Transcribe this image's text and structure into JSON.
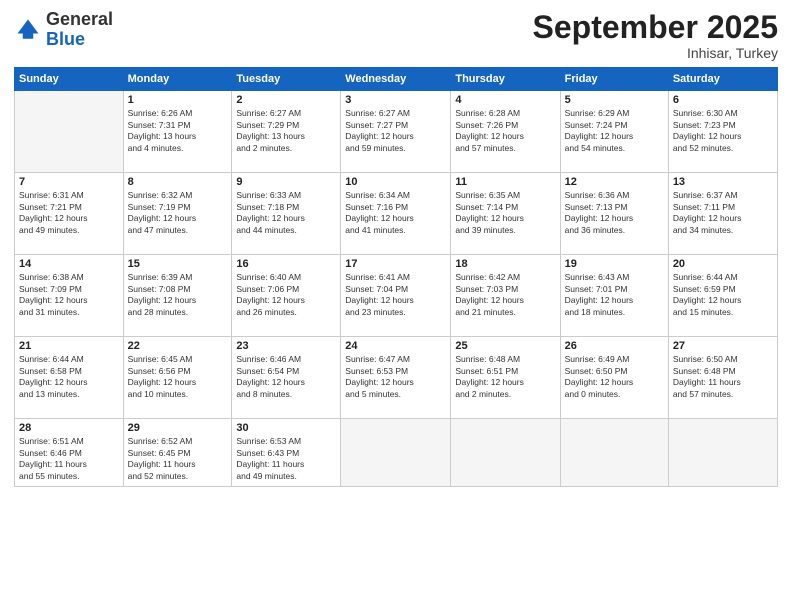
{
  "logo": {
    "general": "General",
    "blue": "Blue"
  },
  "header": {
    "month": "September 2025",
    "location": "Inhisar, Turkey"
  },
  "weekdays": [
    "Sunday",
    "Monday",
    "Tuesday",
    "Wednesday",
    "Thursday",
    "Friday",
    "Saturday"
  ],
  "weeks": [
    [
      {
        "day": "",
        "info": ""
      },
      {
        "day": "1",
        "info": "Sunrise: 6:26 AM\nSunset: 7:31 PM\nDaylight: 13 hours\nand 4 minutes."
      },
      {
        "day": "2",
        "info": "Sunrise: 6:27 AM\nSunset: 7:29 PM\nDaylight: 13 hours\nand 2 minutes."
      },
      {
        "day": "3",
        "info": "Sunrise: 6:27 AM\nSunset: 7:27 PM\nDaylight: 12 hours\nand 59 minutes."
      },
      {
        "day": "4",
        "info": "Sunrise: 6:28 AM\nSunset: 7:26 PM\nDaylight: 12 hours\nand 57 minutes."
      },
      {
        "day": "5",
        "info": "Sunrise: 6:29 AM\nSunset: 7:24 PM\nDaylight: 12 hours\nand 54 minutes."
      },
      {
        "day": "6",
        "info": "Sunrise: 6:30 AM\nSunset: 7:23 PM\nDaylight: 12 hours\nand 52 minutes."
      }
    ],
    [
      {
        "day": "7",
        "info": "Sunrise: 6:31 AM\nSunset: 7:21 PM\nDaylight: 12 hours\nand 49 minutes."
      },
      {
        "day": "8",
        "info": "Sunrise: 6:32 AM\nSunset: 7:19 PM\nDaylight: 12 hours\nand 47 minutes."
      },
      {
        "day": "9",
        "info": "Sunrise: 6:33 AM\nSunset: 7:18 PM\nDaylight: 12 hours\nand 44 minutes."
      },
      {
        "day": "10",
        "info": "Sunrise: 6:34 AM\nSunset: 7:16 PM\nDaylight: 12 hours\nand 41 minutes."
      },
      {
        "day": "11",
        "info": "Sunrise: 6:35 AM\nSunset: 7:14 PM\nDaylight: 12 hours\nand 39 minutes."
      },
      {
        "day": "12",
        "info": "Sunrise: 6:36 AM\nSunset: 7:13 PM\nDaylight: 12 hours\nand 36 minutes."
      },
      {
        "day": "13",
        "info": "Sunrise: 6:37 AM\nSunset: 7:11 PM\nDaylight: 12 hours\nand 34 minutes."
      }
    ],
    [
      {
        "day": "14",
        "info": "Sunrise: 6:38 AM\nSunset: 7:09 PM\nDaylight: 12 hours\nand 31 minutes."
      },
      {
        "day": "15",
        "info": "Sunrise: 6:39 AM\nSunset: 7:08 PM\nDaylight: 12 hours\nand 28 minutes."
      },
      {
        "day": "16",
        "info": "Sunrise: 6:40 AM\nSunset: 7:06 PM\nDaylight: 12 hours\nand 26 minutes."
      },
      {
        "day": "17",
        "info": "Sunrise: 6:41 AM\nSunset: 7:04 PM\nDaylight: 12 hours\nand 23 minutes."
      },
      {
        "day": "18",
        "info": "Sunrise: 6:42 AM\nSunset: 7:03 PM\nDaylight: 12 hours\nand 21 minutes."
      },
      {
        "day": "19",
        "info": "Sunrise: 6:43 AM\nSunset: 7:01 PM\nDaylight: 12 hours\nand 18 minutes."
      },
      {
        "day": "20",
        "info": "Sunrise: 6:44 AM\nSunset: 6:59 PM\nDaylight: 12 hours\nand 15 minutes."
      }
    ],
    [
      {
        "day": "21",
        "info": "Sunrise: 6:44 AM\nSunset: 6:58 PM\nDaylight: 12 hours\nand 13 minutes."
      },
      {
        "day": "22",
        "info": "Sunrise: 6:45 AM\nSunset: 6:56 PM\nDaylight: 12 hours\nand 10 minutes."
      },
      {
        "day": "23",
        "info": "Sunrise: 6:46 AM\nSunset: 6:54 PM\nDaylight: 12 hours\nand 8 minutes."
      },
      {
        "day": "24",
        "info": "Sunrise: 6:47 AM\nSunset: 6:53 PM\nDaylight: 12 hours\nand 5 minutes."
      },
      {
        "day": "25",
        "info": "Sunrise: 6:48 AM\nSunset: 6:51 PM\nDaylight: 12 hours\nand 2 minutes."
      },
      {
        "day": "26",
        "info": "Sunrise: 6:49 AM\nSunset: 6:50 PM\nDaylight: 12 hours\nand 0 minutes."
      },
      {
        "day": "27",
        "info": "Sunrise: 6:50 AM\nSunset: 6:48 PM\nDaylight: 11 hours\nand 57 minutes."
      }
    ],
    [
      {
        "day": "28",
        "info": "Sunrise: 6:51 AM\nSunset: 6:46 PM\nDaylight: 11 hours\nand 55 minutes."
      },
      {
        "day": "29",
        "info": "Sunrise: 6:52 AM\nSunset: 6:45 PM\nDaylight: 11 hours\nand 52 minutes."
      },
      {
        "day": "30",
        "info": "Sunrise: 6:53 AM\nSunset: 6:43 PM\nDaylight: 11 hours\nand 49 minutes."
      },
      {
        "day": "",
        "info": ""
      },
      {
        "day": "",
        "info": ""
      },
      {
        "day": "",
        "info": ""
      },
      {
        "day": "",
        "info": ""
      }
    ]
  ]
}
